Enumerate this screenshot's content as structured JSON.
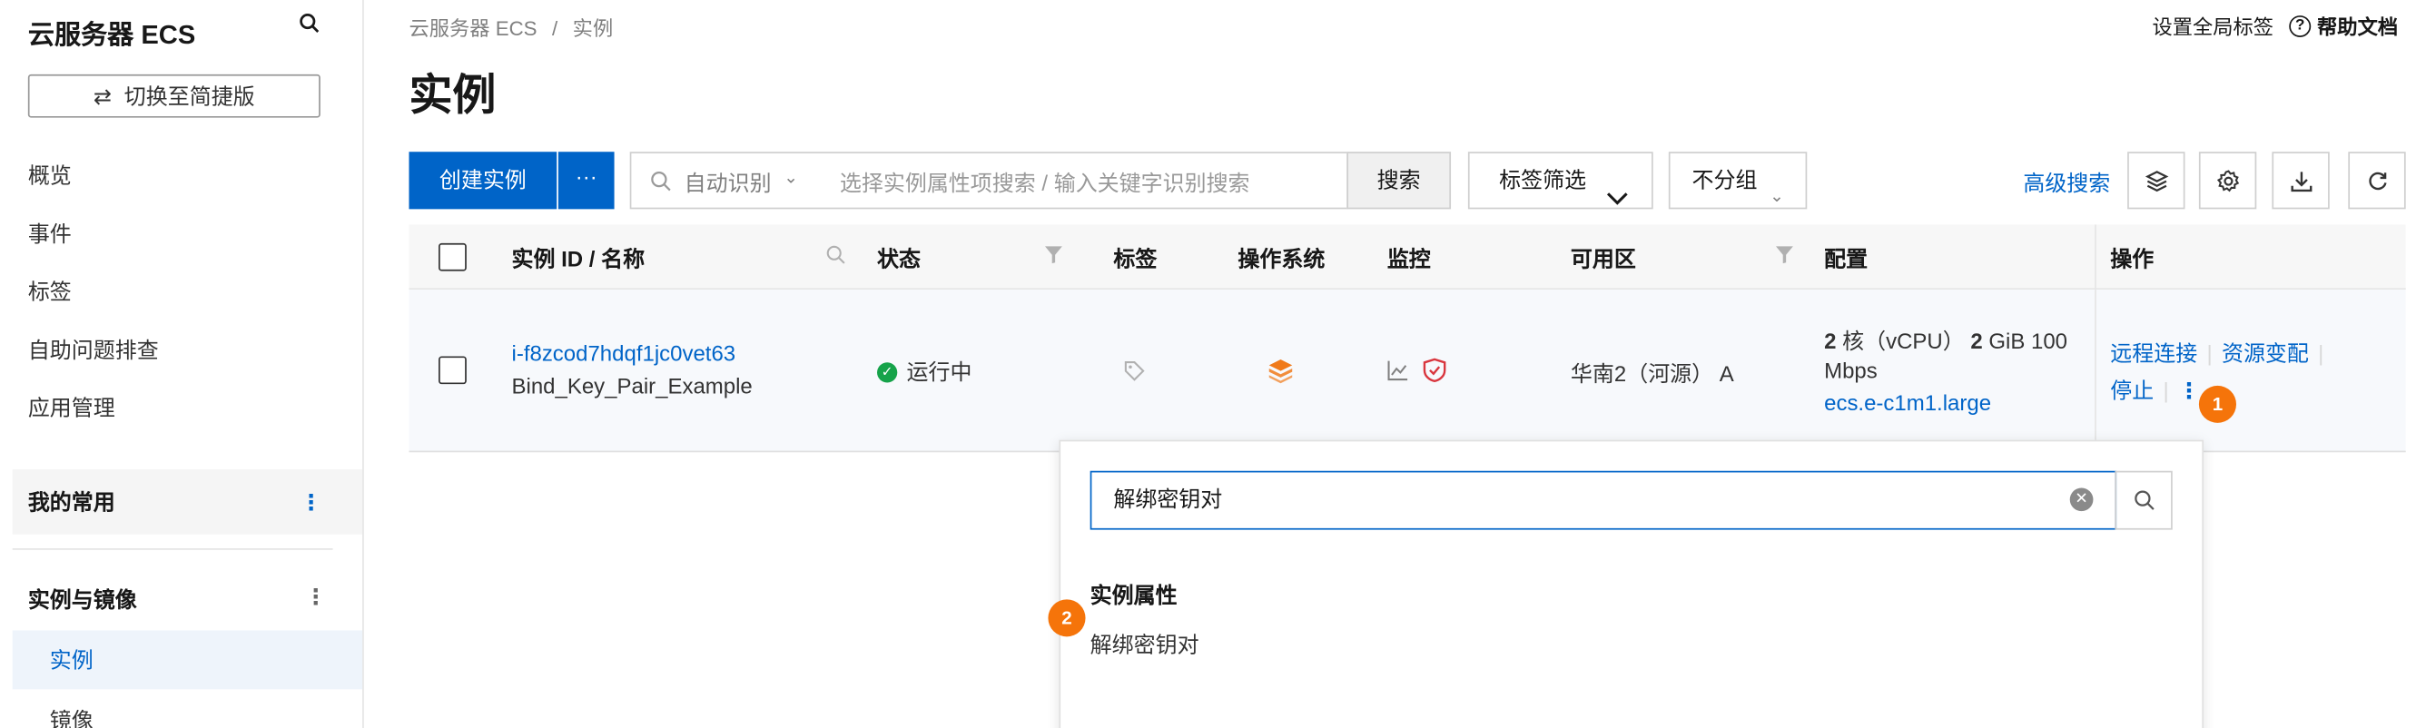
{
  "sidebar": {
    "title": "云服务器 ECS",
    "switch_label": "切换至简捷版",
    "items": [
      {
        "label": "概览"
      },
      {
        "label": "事件"
      },
      {
        "label": "标签"
      },
      {
        "label": "自助问题排查"
      },
      {
        "label": "应用管理"
      }
    ],
    "favorites_label": "我的常用",
    "section_label": "实例与镜像",
    "active_item": "实例",
    "next_item": "镜像"
  },
  "breadcrumb": {
    "root": "云服务器 ECS",
    "separator": "/",
    "current": "实例"
  },
  "header": {
    "tag_settings": "设置全局标签",
    "help": "帮助文档",
    "help_icon": "?"
  },
  "page_title": "实例",
  "toolbar": {
    "create_label": "创建实例",
    "more_label": "···",
    "search_mode": "自动识别",
    "search_placeholder": "选择实例属性项搜索 / 输入关键字识别搜索",
    "search_button": "搜索",
    "tag_filter": "标签筛选",
    "group_select": "不分组",
    "advanced_search": "高级搜索"
  },
  "table": {
    "columns": [
      "实例 ID / 名称",
      "状态",
      "标签",
      "操作系统",
      "监控",
      "可用区",
      "配置",
      "操作"
    ],
    "rows": [
      {
        "instance_id": "i-f8zcod7hdqf1jc0vet63",
        "name": "Bind_Key_Pair_Example",
        "status": "运行中",
        "zone": "华南2（河源） A",
        "config_cpu_num": "2",
        "config_cpu_unit": " 核（vCPU） ",
        "config_mem_num": "2",
        "config_mem_unit": " GiB 100",
        "config_bw": "Mbps",
        "config_type": "ecs.e-c1m1.large",
        "actions": [
          "远程连接",
          "资源变配",
          "停止"
        ]
      }
    ]
  },
  "popover": {
    "input_value": "解绑密钥对",
    "heading": "实例属性",
    "option": "解绑密钥对"
  },
  "annotations": {
    "badge1": "1",
    "badge2": "2"
  },
  "colors": {
    "primary": "#0064c8",
    "badge": "#f5740a",
    "running": "#16a34a",
    "os_icon": "#f07a1a",
    "security": "#d9363e"
  }
}
